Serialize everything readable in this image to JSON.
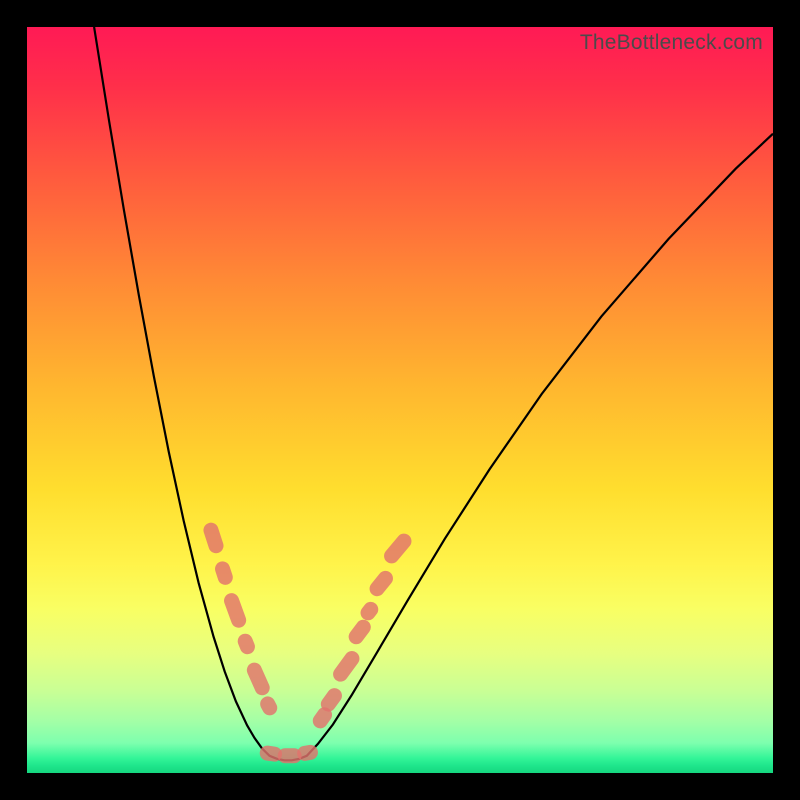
{
  "watermark": "TheBottleneck.com",
  "colors": {
    "frame": "#000000",
    "curve": "#000000",
    "marker": "#e2736d"
  },
  "chart_data": {
    "type": "line",
    "title": "",
    "xlabel": "",
    "ylabel": "",
    "xlim": [
      0,
      100
    ],
    "ylim": [
      0,
      100
    ],
    "note": "Axes are unlabeled in the source image; x and y are normalized 0–100 (y=0 at top, y=100 at bottom). Curve values are estimated from pixel positions.",
    "series": [
      {
        "name": "left-curve",
        "x": [
          9,
          11,
          13,
          15,
          17,
          19,
          21,
          23,
          25,
          26.5,
          28,
          29.5,
          30.5,
          31.5,
          32.5
        ],
        "y": [
          0,
          12.6,
          24.6,
          36.0,
          46.8,
          56.9,
          66.2,
          74.5,
          81.7,
          86.4,
          90.4,
          93.6,
          95.3,
          96.7,
          97.7
        ]
      },
      {
        "name": "flat-bottom",
        "x": [
          32.5,
          33.5,
          34.5,
          35.5,
          36.5,
          37.5
        ],
        "y": [
          97.7,
          98.1,
          98.3,
          98.3,
          98.1,
          97.7
        ]
      },
      {
        "name": "right-curve",
        "x": [
          37.5,
          39,
          41,
          43.5,
          47,
          51,
          56,
          62,
          69,
          77,
          86,
          95,
          100
        ],
        "y": [
          97.7,
          96.1,
          93.5,
          89.6,
          83.7,
          76.9,
          68.6,
          59.3,
          49.2,
          38.8,
          28.4,
          19.0,
          14.3
        ]
      }
    ],
    "markers": {
      "name": "highlighted-points",
      "note": "Each marker is a short capsule segment on the curve; x,y in same 0–100 space, rotation in degrees from horizontal, length in same units.",
      "points": [
        {
          "x": 25.0,
          "y": 68.5,
          "rotation": 72,
          "length": 4.2
        },
        {
          "x": 26.4,
          "y": 73.2,
          "rotation": 72,
          "length": 3.2
        },
        {
          "x": 27.9,
          "y": 78.2,
          "rotation": 70,
          "length": 4.8
        },
        {
          "x": 29.4,
          "y": 82.7,
          "rotation": 68,
          "length": 2.8
        },
        {
          "x": 31.0,
          "y": 87.4,
          "rotation": 66,
          "length": 4.6
        },
        {
          "x": 32.4,
          "y": 91.0,
          "rotation": 62,
          "length": 2.6
        },
        {
          "x": 32.7,
          "y": 97.4,
          "rotation": 8,
          "length": 3.0
        },
        {
          "x": 35.2,
          "y": 97.7,
          "rotation": 0,
          "length": 3.2
        },
        {
          "x": 37.6,
          "y": 97.3,
          "rotation": -10,
          "length": 2.8
        },
        {
          "x": 39.6,
          "y": 92.6,
          "rotation": -55,
          "length": 3.0
        },
        {
          "x": 40.8,
          "y": 90.2,
          "rotation": -54,
          "length": 3.4
        },
        {
          "x": 42.8,
          "y": 85.7,
          "rotation": -54,
          "length": 4.6
        },
        {
          "x": 44.6,
          "y": 81.1,
          "rotation": -53,
          "length": 3.6
        },
        {
          "x": 45.9,
          "y": 78.3,
          "rotation": -52,
          "length": 2.6
        },
        {
          "x": 47.5,
          "y": 74.6,
          "rotation": -51,
          "length": 3.8
        },
        {
          "x": 49.7,
          "y": 69.9,
          "rotation": -50,
          "length": 4.6
        }
      ]
    }
  }
}
